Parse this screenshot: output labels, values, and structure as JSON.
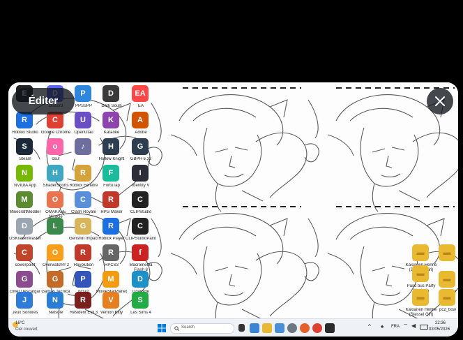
{
  "media_overlay": {
    "edit_label": "Éditer"
  },
  "desktop": {
    "icons": [
      {
        "label": "",
        "icon": "epic-games-icon",
        "color": "#222222",
        "glyph": "E"
      },
      {
        "label": "Roblox Studio",
        "icon": "roblox-studio-icon",
        "color": "#1d6fe0",
        "glyph": "R"
      },
      {
        "label": "Steam",
        "icon": "steam-icon",
        "color": "#1b2838",
        "glyph": "S"
      },
      {
        "label": "NVIDIA App",
        "icon": "nvidia-icon",
        "color": "#76b900",
        "glyph": "N"
      },
      {
        "label": "MinecraftModder",
        "icon": "minecraft-icon",
        "color": "#5b8c32",
        "glyph": "M"
      },
      {
        "label": "DSKrakenMaster",
        "icon": "sword-icon",
        "color": "#9aa5b1",
        "glyph": "D"
      },
      {
        "label": "cowerpoint",
        "icon": "character-icon",
        "color": "#c0452b",
        "glyph": "C"
      },
      {
        "label": "Giver Descargar",
        "icon": "character-icon",
        "color": "#8a4b8f",
        "glyph": "G"
      },
      {
        "label": "Jeux Sonores",
        "icon": "game-folder-icon",
        "color": "#2f7bd8",
        "glyph": "J"
      },
      {
        "label": "Discord",
        "icon": "discord-icon",
        "color": "#5865f2",
        "glyph": "D"
      },
      {
        "label": "Google Chrome",
        "icon": "chrome-icon",
        "color": "#de4032",
        "glyph": "C"
      },
      {
        "label": "osu!",
        "icon": "osu-icon",
        "color": "#ff66aa",
        "glyph": "o"
      },
      {
        "label": "ShaderShorts",
        "icon": "character-icon",
        "color": "#3fa7c4",
        "glyph": "H"
      },
      {
        "label": "OMAKASE Miracle",
        "icon": "character-icon",
        "color": "#e9734f",
        "glyph": "O"
      },
      {
        "label": "",
        "icon": "character-icon",
        "color": "#3b8a4c",
        "glyph": "L"
      },
      {
        "label": "Overwatch® 2",
        "icon": "overwatch-icon",
        "color": "#f99e1a",
        "glyph": "O"
      },
      {
        "label": "Games Tecnica",
        "icon": "game-folder-icon",
        "color": "#c46b2a",
        "glyph": "G"
      },
      {
        "label": "Netsole",
        "icon": "app-icon",
        "color": "#2a7fd4",
        "glyph": "N"
      },
      {
        "label": "PPSSPP",
        "icon": "ppsspp-icon",
        "color": "#2e86de",
        "glyph": "P"
      },
      {
        "label": "OpenUtau",
        "icon": "openutau-icon",
        "color": "#6a4fc4",
        "glyph": "U"
      },
      {
        "label": "",
        "icon": "music-icon",
        "color": "#6e6e9e",
        "glyph": "♪"
      },
      {
        "label": "Roblox Fenêtre",
        "icon": "character-icon",
        "color": "#d6a33a",
        "glyph": "R"
      },
      {
        "label": "Clash Royale",
        "icon": "character-icon",
        "color": "#5a8ed8",
        "glyph": "C"
      },
      {
        "label": "Genshin Impact",
        "icon": "genshin-icon",
        "color": "#d8b45a",
        "glyph": "G"
      },
      {
        "label": "Revolution",
        "icon": "character-icon",
        "color": "#c0392b",
        "glyph": "R"
      },
      {
        "label": "pcsx2",
        "icon": "pcsx2-icon",
        "color": "#3355bb",
        "glyph": "P"
      },
      {
        "label": "Resident Evil 3",
        "icon": "character-icon",
        "color": "#7a1e1e",
        "glyph": "R"
      },
      {
        "label": "Dark Souls",
        "icon": "character-icon",
        "color": "#3a3a3a",
        "glyph": "D"
      },
      {
        "label": "Karaoke",
        "icon": "character-icon",
        "color": "#8e44ad",
        "glyph": "K"
      },
      {
        "label": "Hollow Knight",
        "icon": "hollow-knight-icon",
        "color": "#2c3e50",
        "glyph": "H"
      },
      {
        "label": "FortuTap",
        "icon": "app-icon",
        "color": "#1abc9c",
        "glyph": "F"
      },
      {
        "label": "RPG Maker",
        "icon": "rpg-maker-icon",
        "color": "#c0392b",
        "glyph": "R"
      },
      {
        "label": "Roblox Player",
        "icon": "roblox-player-icon",
        "color": "#1d6fe0",
        "glyph": "R"
      },
      {
        "label": "RPCS3",
        "icon": "rpcs3-icon",
        "color": "#666666",
        "glyph": "R"
      },
      {
        "label": "MovieStarPlanet",
        "icon": "character-icon",
        "color": "#f39c12",
        "glyph": "M"
      },
      {
        "label": "Vernon Kitty",
        "icon": "character-icon",
        "color": "#e67e22",
        "glyph": "V"
      },
      {
        "label": "EA",
        "icon": "ea-icon",
        "color": "#ff4747",
        "glyph": "EA"
      },
      {
        "label": "Adobe",
        "icon": "character-icon",
        "color": "#d35400",
        "glyph": "A"
      },
      {
        "label": "GBPH 6.32",
        "icon": "app-icon",
        "color": "#2c3e50",
        "glyph": "G"
      },
      {
        "label": "Identity V",
        "icon": "identity-v-icon",
        "color": "#2d2d3a",
        "glyph": "I"
      },
      {
        "label": "CLIPStudio",
        "icon": "clip-studio-icon",
        "color": "#222222",
        "glyph": "C"
      },
      {
        "label": "CLIPStudioPaint",
        "icon": "clip-studio-paint-icon",
        "color": "#222222",
        "glyph": "C"
      },
      {
        "label": "Macromedia Flash 8",
        "icon": "flash-icon",
        "color": "#cc2222",
        "glyph": "f"
      },
      {
        "label": "Doanyde",
        "icon": "app-icon",
        "color": "#1e90c8",
        "glyph": "D"
      },
      {
        "label": "Les Sims 4",
        "icon": "sims-icon",
        "color": "#22aa44",
        "glyph": "S"
      }
    ],
    "right_icons": [
      {
        "label": "Kaloanen Henne (Stessel Girl)",
        "icon": "folder-icon",
        "color": "#e8b931",
        "glyph": "▬"
      },
      {
        "label": "",
        "icon": "folder-icon",
        "color": "#e8b931",
        "glyph": "▬"
      },
      {
        "label": "pc2_bow",
        "icon": "folder-icon",
        "color": "#e8b931",
        "glyph": "▬"
      },
      {
        "label": "Paso bus Parfy Mozimia",
        "icon": "folder-icon",
        "color": "#e8b931",
        "glyph": "▬"
      },
      {
        "label": "pc2_bow",
        "icon": "folder-icon",
        "color": "#e8b931",
        "glyph": "▬"
      },
      {
        "label": "Kaloanen Henne (Stessel Girl)",
        "icon": "folder-icon",
        "color": "#e8b931",
        "glyph": "▬"
      }
    ]
  },
  "taskbar": {
    "weather_temp": "16°C",
    "weather_desc": "Ciel couvert",
    "search_placeholder": "Search",
    "language": "FRA",
    "time": "22:36",
    "date": "02/05/2026"
  },
  "colors": {
    "page_bg": "#000000",
    "text": "#e7e9ea",
    "overlay_btn": "#0f1419",
    "taskbar_bg": "#eef1f6",
    "windows_blue": "#0078d4"
  }
}
